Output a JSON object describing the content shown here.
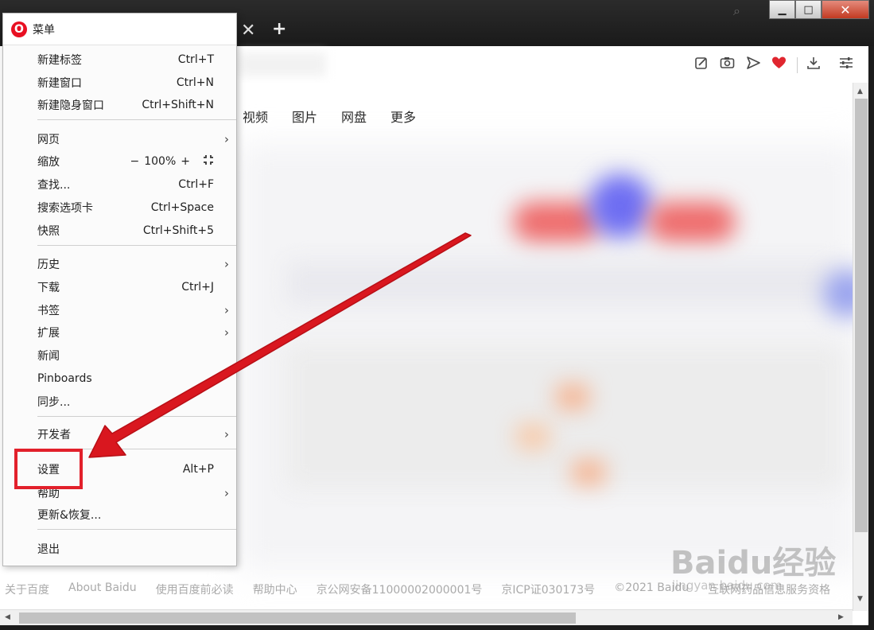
{
  "tab_bar": {
    "close_glyph": "✕",
    "new_tab_glyph": "+"
  },
  "window_controls": {
    "minimize": "▁",
    "maximize": "□",
    "close": "✕"
  },
  "toolbar_icons": [
    "snap-icon",
    "camera-icon",
    "send-icon",
    "heart-icon",
    "download-icon",
    "easy-setup-icon"
  ],
  "baidu_nav": [
    "视频",
    "图片",
    "网盘",
    "更多"
  ],
  "footer": [
    "关于百度",
    "About Baidu",
    "使用百度前必读",
    "帮助中心",
    "京公网安备11000002000001号",
    "京ICP证030173号",
    "©2021 Baidu",
    "互联网药品信息服务资格"
  ],
  "menu": {
    "logo": "O",
    "title": "菜单",
    "groups": [
      [
        {
          "label": "新建标签",
          "shortcut": "Ctrl+T"
        },
        {
          "label": "新建窗口",
          "shortcut": "Ctrl+N"
        },
        {
          "label": "新建隐身窗口",
          "shortcut": "Ctrl+Shift+N"
        }
      ],
      [
        {
          "label": "网页",
          "submenu": true
        },
        {
          "label": "缩放",
          "zoom": {
            "minus": "−",
            "value": "100%",
            "plus": "+"
          }
        },
        {
          "label": "查找...",
          "shortcut": "Ctrl+F"
        },
        {
          "label": "搜索选项卡",
          "shortcut": "Ctrl+Space"
        },
        {
          "label": "快照",
          "shortcut": "Ctrl+Shift+5"
        }
      ],
      [
        {
          "label": "历史",
          "submenu": true
        },
        {
          "label": "下载",
          "shortcut": "Ctrl+J"
        },
        {
          "label": "书签",
          "submenu": true
        },
        {
          "label": "扩展",
          "submenu": true
        },
        {
          "label": "新闻"
        },
        {
          "label": "Pinboards"
        },
        {
          "label": "同步..."
        }
      ],
      [
        {
          "label": "开发者",
          "submenu": true
        },
        {
          "label": "设置",
          "shortcut": "Alt+P"
        },
        {
          "label": "帮助",
          "submenu": true
        },
        {
          "label": "更新&恢复..."
        }
      ],
      [
        {
          "label": "退出"
        }
      ]
    ]
  },
  "watermark": {
    "main": "Baidu经验",
    "sub": "jingyan.baidu.com"
  },
  "colors": {
    "annotation_red": "#e2202b",
    "opera_red": "#e81022",
    "heart": "#e0262f"
  }
}
